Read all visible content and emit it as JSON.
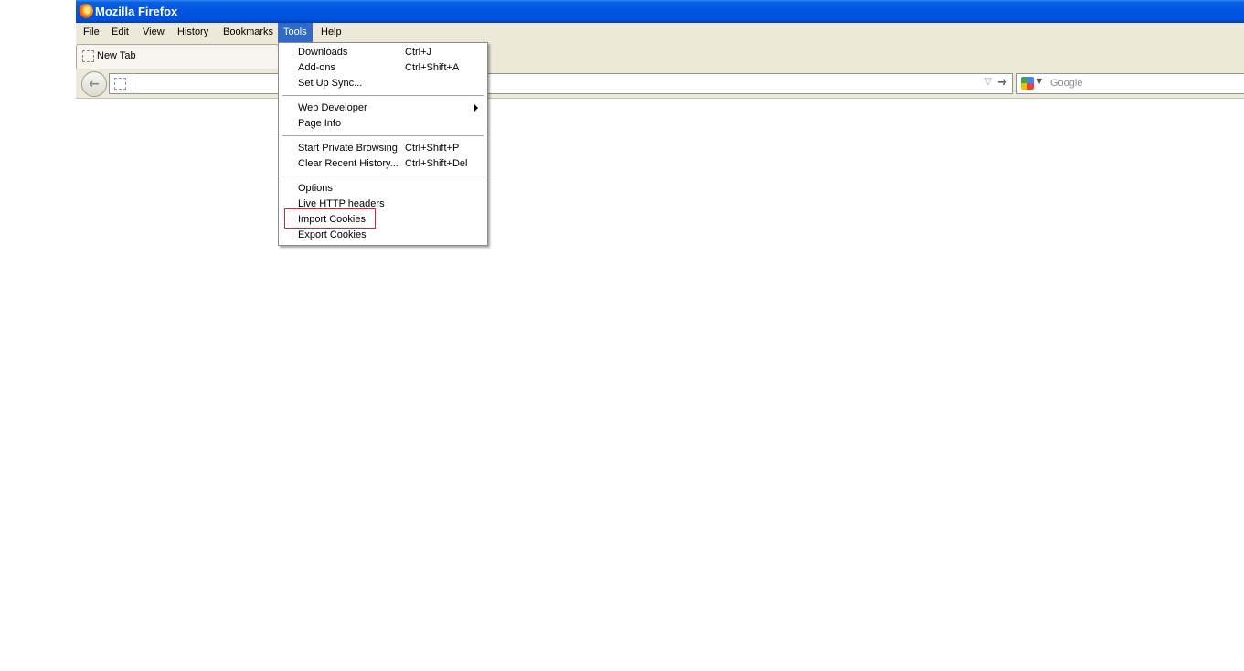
{
  "window": {
    "title": "Mozilla Firefox"
  },
  "menubar": {
    "items": [
      {
        "label": "File"
      },
      {
        "label": "Edit"
      },
      {
        "label": "View"
      },
      {
        "label": "History"
      },
      {
        "label": "Bookmarks"
      },
      {
        "label": "Tools",
        "active": true
      },
      {
        "label": "Help"
      }
    ]
  },
  "tab": {
    "label": "New Tab"
  },
  "search": {
    "placeholder": "Google"
  },
  "tools_menu": {
    "items": [
      {
        "label": "Downloads",
        "shortcut": "Ctrl+J"
      },
      {
        "label": "Add-ons",
        "shortcut": "Ctrl+Shift+A"
      },
      {
        "label": "Set Up Sync...",
        "shortcut": ""
      },
      {
        "label": "Web Developer",
        "shortcut": "",
        "submenu": true
      },
      {
        "label": "Page Info",
        "shortcut": ""
      },
      {
        "label": "Start Private Browsing",
        "shortcut": "Ctrl+Shift+P"
      },
      {
        "label": "Clear Recent History...",
        "shortcut": "Ctrl+Shift+Del"
      },
      {
        "label": "Options",
        "shortcut": ""
      },
      {
        "label": "Live HTTP headers",
        "shortcut": ""
      },
      {
        "label": "Import Cookies",
        "shortcut": "",
        "highlighted": true
      },
      {
        "label": "Export Cookies",
        "shortcut": ""
      }
    ]
  },
  "colors": {
    "title_bar": "#0054e3",
    "menu_active": "#316ac5",
    "highlight_box": "#e0202a"
  }
}
